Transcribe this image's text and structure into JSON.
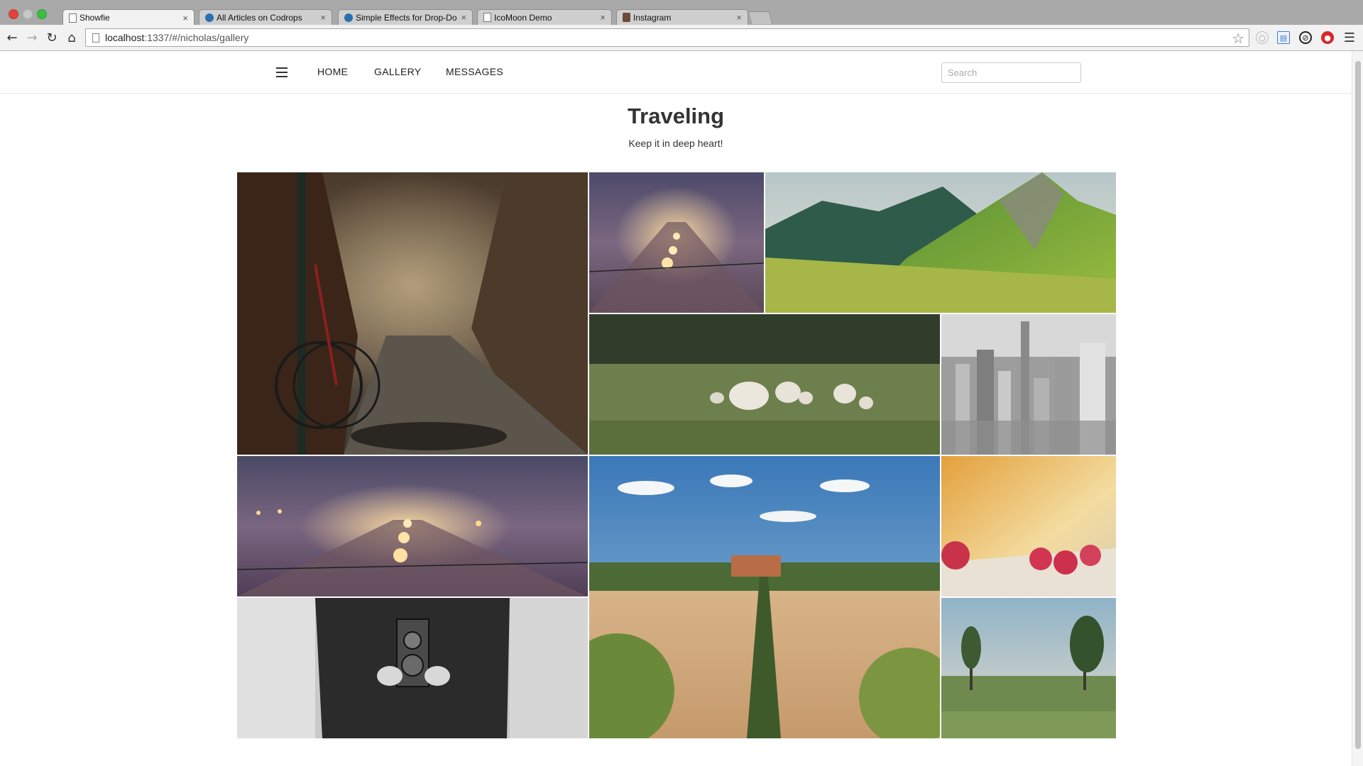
{
  "browser": {
    "tabs": [
      {
        "title": "Showfie",
        "icon": "document-icon",
        "active": true
      },
      {
        "title": "All Articles on Codrops",
        "icon": "codrops-drop-icon",
        "active": false
      },
      {
        "title": "Simple Effects for Drop-Do",
        "icon": "codrops-drop-icon",
        "active": false
      },
      {
        "title": "IcoMoon Demo",
        "icon": "document-icon",
        "active": false
      },
      {
        "title": "Instagram",
        "icon": "instagram-icon",
        "active": false
      }
    ],
    "tab_close_glyph": "×",
    "url_host": "localhost",
    "url_rest": ":1337/#/nicholas/gallery"
  },
  "nav": {
    "links": [
      "HOME",
      "GALLERY",
      "MESSAGES"
    ],
    "search_placeholder": "Search"
  },
  "album": {
    "title": "Traveling",
    "subtitle": "Keep it in deep heart!"
  },
  "gallery": {
    "photos": [
      {
        "name": "photo-bicycle-alley",
        "subject": "bicycle leaning against brick wall in alley"
      },
      {
        "name": "photo-railway-night-small",
        "subject": "railway tracks with lights in fog"
      },
      {
        "name": "photo-green-mountain",
        "subject": "green mountain slope landscape"
      },
      {
        "name": "photo-sheep-meadow",
        "subject": "sheep in a meadow"
      },
      {
        "name": "photo-city-skyline",
        "subject": "city skyline black and white"
      },
      {
        "name": "photo-railway-night-wide",
        "subject": "railway tracks with lights in fog"
      },
      {
        "name": "photo-tuscany-road",
        "subject": "cypress-lined road through field"
      },
      {
        "name": "photo-raspberries",
        "subject": "raspberries close-up"
      },
      {
        "name": "photo-camera-person",
        "subject": "person holding vintage camera"
      },
      {
        "name": "photo-marsh-trees",
        "subject": "marsh with trees"
      }
    ]
  },
  "colors": {
    "text": "#333333",
    "nav_border": "#e6e6e6",
    "tab_active": "#f2f2f2"
  }
}
